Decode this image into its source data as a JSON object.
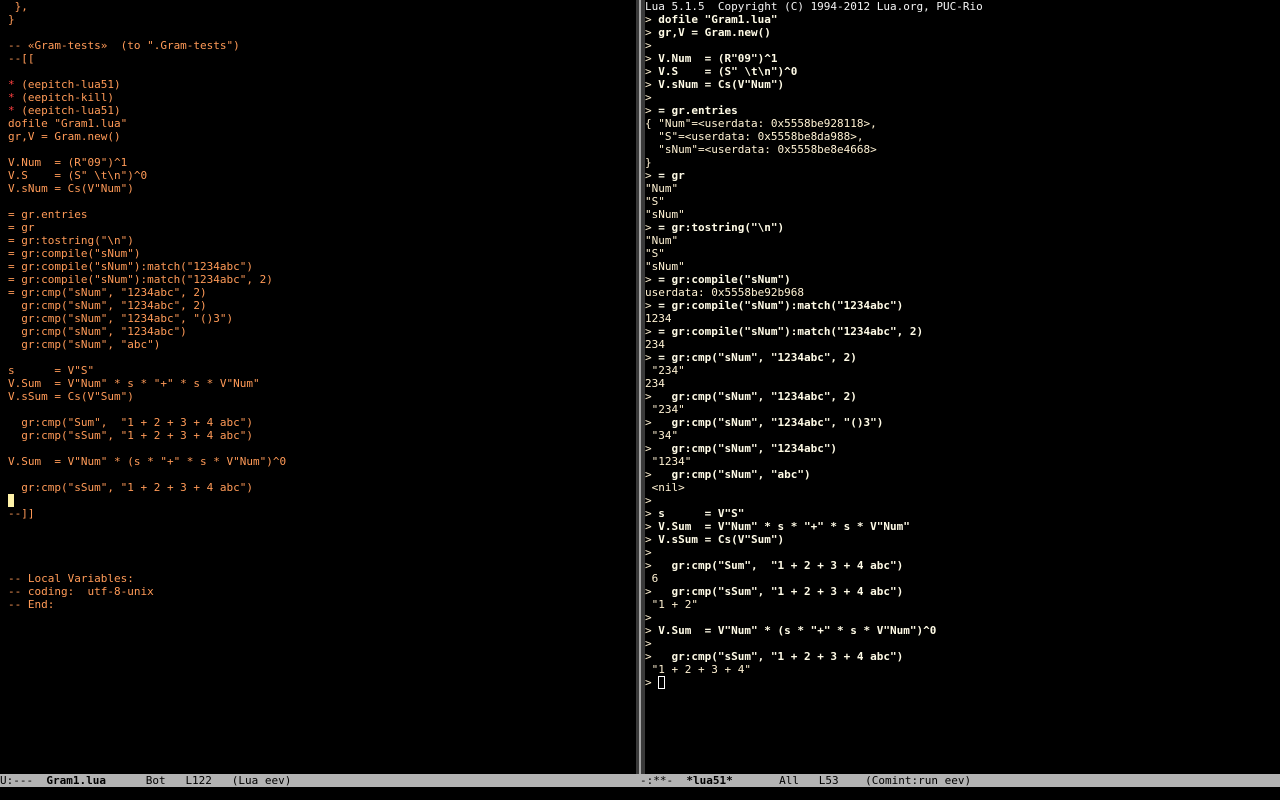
{
  "left_buffer": {
    "lines": [
      {
        "text": " },",
        "color": "orange"
      },
      {
        "text": "}",
        "color": "orange"
      },
      {
        "text": "",
        "color": "orange"
      },
      {
        "text": "-- «Gram-tests»  (to \".Gram-tests\")",
        "color": "orange"
      },
      {
        "text": "--[[",
        "color": "orange"
      },
      {
        "text": "",
        "color": "orange"
      },
      {
        "star": "*",
        "text": " (eepitch-lua51)",
        "color": "orange"
      },
      {
        "star": "*",
        "text": " (eepitch-kill)",
        "color": "orange"
      },
      {
        "star": "*",
        "text": " (eepitch-lua51)",
        "color": "orange"
      },
      {
        "text": "dofile \"Gram1.lua\"",
        "color": "orange"
      },
      {
        "text": "gr,V = Gram.new()",
        "color": "orange"
      },
      {
        "text": "",
        "color": "orange"
      },
      {
        "text": "V.Num  = (R\"09\")^1",
        "color": "orange"
      },
      {
        "text": "V.S    = (S\" \\t\\n\")^0",
        "color": "orange"
      },
      {
        "text": "V.sNum = Cs(V\"Num\")",
        "color": "orange"
      },
      {
        "text": "",
        "color": "orange"
      },
      {
        "text": "= gr.entries",
        "color": "orange"
      },
      {
        "text": "= gr",
        "color": "orange"
      },
      {
        "text": "= gr:tostring(\"\\n\")",
        "color": "orange"
      },
      {
        "text": "= gr:compile(\"sNum\")",
        "color": "orange"
      },
      {
        "text": "= gr:compile(\"sNum\"):match(\"1234abc\")",
        "color": "orange"
      },
      {
        "text": "= gr:compile(\"sNum\"):match(\"1234abc\", 2)",
        "color": "orange"
      },
      {
        "text": "= gr:cmp(\"sNum\", \"1234abc\", 2)",
        "color": "orange"
      },
      {
        "text": "  gr:cmp(\"sNum\", \"1234abc\", 2)",
        "color": "orange"
      },
      {
        "text": "  gr:cmp(\"sNum\", \"1234abc\", \"()3\")",
        "color": "orange"
      },
      {
        "text": "  gr:cmp(\"sNum\", \"1234abc\")",
        "color": "orange"
      },
      {
        "text": "  gr:cmp(\"sNum\", \"abc\")",
        "color": "orange"
      },
      {
        "text": "",
        "color": "orange"
      },
      {
        "text": "s      = V\"S\"",
        "color": "orange"
      },
      {
        "text": "V.Sum  = V\"Num\" * s * \"+\" * s * V\"Num\"",
        "color": "orange"
      },
      {
        "text": "V.sSum = Cs(V\"Sum\")",
        "color": "orange"
      },
      {
        "text": "",
        "color": "orange"
      },
      {
        "text": "  gr:cmp(\"Sum\",  \"1 + 2 + 3 + 4 abc\")",
        "color": "orange"
      },
      {
        "text": "  gr:cmp(\"sSum\", \"1 + 2 + 3 + 4 abc\")",
        "color": "orange"
      },
      {
        "text": "",
        "color": "orange"
      },
      {
        "text": "V.Sum  = V\"Num\" * (s * \"+\" * s * V\"Num\")^0",
        "color": "orange"
      },
      {
        "text": "",
        "color": "orange"
      },
      {
        "text": "  gr:cmp(\"sSum\", \"1 + 2 + 3 + 4 abc\")",
        "color": "orange"
      },
      {
        "text": "",
        "color": "orange",
        "cursor": true
      },
      {
        "text": "--]]",
        "color": "orange"
      },
      {
        "text": "",
        "color": "orange"
      },
      {
        "text": "",
        "color": "orange"
      },
      {
        "text": "",
        "color": "orange"
      },
      {
        "text": "",
        "color": "orange"
      },
      {
        "text": "-- Local Variables:",
        "color": "orange"
      },
      {
        "text": "-- coding:  utf-8-unix",
        "color": "orange"
      },
      {
        "text": "-- End:",
        "color": "orange"
      }
    ]
  },
  "right_buffer": {
    "lines": [
      {
        "text": "Lua 5.1.5  Copyright (C) 1994-2012 Lua.org, PUC-Rio",
        "color": "white"
      },
      {
        "prompt": "> ",
        "text": "dofile \"Gram1.lua\"",
        "color": "bold"
      },
      {
        "prompt": "> ",
        "text": "gr,V = Gram.new()",
        "color": "bold"
      },
      {
        "prompt": "> ",
        "text": "",
        "color": "bold"
      },
      {
        "prompt": "> ",
        "text": "V.Num  = (R\"09\")^1",
        "color": "bold"
      },
      {
        "prompt": "> ",
        "text": "V.S    = (S\" \\t\\n\")^0",
        "color": "bold"
      },
      {
        "prompt": "> ",
        "text": "V.sNum = Cs(V\"Num\")",
        "color": "bold"
      },
      {
        "prompt": "> ",
        "text": "",
        "color": "bold"
      },
      {
        "prompt": "> ",
        "text": "= gr.entries",
        "color": "bold"
      },
      {
        "text": "{ \"Num\"=<userdata: 0x5558be928118>,",
        "color": "cream"
      },
      {
        "text": "  \"S\"=<userdata: 0x5558be8da988>,",
        "color": "cream"
      },
      {
        "text": "  \"sNum\"=<userdata: 0x5558be8e4668>",
        "color": "cream"
      },
      {
        "text": "}",
        "color": "cream"
      },
      {
        "prompt": "> ",
        "text": "= gr",
        "color": "bold"
      },
      {
        "text": "\"Num\"",
        "color": "cream"
      },
      {
        "text": "\"S\"",
        "color": "cream"
      },
      {
        "text": "\"sNum\"",
        "color": "cream"
      },
      {
        "prompt": "> ",
        "text": "= gr:tostring(\"\\n\")",
        "color": "bold"
      },
      {
        "text": "\"Num\"",
        "color": "cream"
      },
      {
        "text": "\"S\"",
        "color": "cream"
      },
      {
        "text": "\"sNum\"",
        "color": "cream"
      },
      {
        "prompt": "> ",
        "text": "= gr:compile(\"sNum\")",
        "color": "bold"
      },
      {
        "text": "userdata: 0x5558be92b968",
        "color": "cream"
      },
      {
        "prompt": "> ",
        "text": "= gr:compile(\"sNum\"):match(\"1234abc\")",
        "color": "bold"
      },
      {
        "text": "1234",
        "color": "cream"
      },
      {
        "prompt": "> ",
        "text": "= gr:compile(\"sNum\"):match(\"1234abc\", 2)",
        "color": "bold"
      },
      {
        "text": "234",
        "color": "cream"
      },
      {
        "prompt": "> ",
        "text": "= gr:cmp(\"sNum\", \"1234abc\", 2)",
        "color": "bold"
      },
      {
        "text": " \"234\"",
        "color": "cream"
      },
      {
        "text": "234",
        "color": "cream"
      },
      {
        "prompt": "> ",
        "text": "  gr:cmp(\"sNum\", \"1234abc\", 2)",
        "color": "bold"
      },
      {
        "text": " \"234\"",
        "color": "cream"
      },
      {
        "prompt": "> ",
        "text": "  gr:cmp(\"sNum\", \"1234abc\", \"()3\")",
        "color": "bold"
      },
      {
        "text": " \"34\"",
        "color": "cream"
      },
      {
        "prompt": "> ",
        "text": "  gr:cmp(\"sNum\", \"1234abc\")",
        "color": "bold"
      },
      {
        "text": " \"1234\"",
        "color": "cream"
      },
      {
        "prompt": "> ",
        "text": "  gr:cmp(\"sNum\", \"abc\")",
        "color": "bold"
      },
      {
        "text": " <nil>",
        "color": "cream"
      },
      {
        "prompt": "> ",
        "text": "",
        "color": "bold"
      },
      {
        "prompt": "> ",
        "text": "s      = V\"S\"",
        "color": "bold"
      },
      {
        "prompt": "> ",
        "text": "V.Sum  = V\"Num\" * s * \"+\" * s * V\"Num\"",
        "color": "bold"
      },
      {
        "prompt": "> ",
        "text": "V.sSum = Cs(V\"Sum\")",
        "color": "bold"
      },
      {
        "prompt": "> ",
        "text": "",
        "color": "bold"
      },
      {
        "prompt": "> ",
        "text": "  gr:cmp(\"Sum\",  \"1 + 2 + 3 + 4 abc\")",
        "color": "bold"
      },
      {
        "text": " 6",
        "color": "cream"
      },
      {
        "prompt": "> ",
        "text": "  gr:cmp(\"sSum\", \"1 + 2 + 3 + 4 abc\")",
        "color": "bold"
      },
      {
        "text": " \"1 + 2\"",
        "color": "cream"
      },
      {
        "prompt": "> ",
        "text": "",
        "color": "bold"
      },
      {
        "prompt": "> ",
        "text": "V.Sum  = V\"Num\" * (s * \"+\" * s * V\"Num\")^0",
        "color": "bold"
      },
      {
        "prompt": "> ",
        "text": "",
        "color": "bold"
      },
      {
        "prompt": "> ",
        "text": "  gr:cmp(\"sSum\", \"1 + 2 + 3 + 4 abc\")",
        "color": "bold"
      },
      {
        "text": " \"1 + 2 + 3 + 4\"",
        "color": "cream"
      },
      {
        "prompt": "> ",
        "text": "",
        "color": "bold",
        "cursor": true
      }
    ]
  },
  "left_modeline": {
    "status": "U:---  ",
    "buffer_name": "Gram1.lua",
    "rest": "      Bot   L122   (Lua eev)"
  },
  "right_modeline": {
    "status": "-:**-  ",
    "buffer_name": "*lua51*",
    "rest": "       All   L53    (Comint:run eev)"
  },
  "colors": {
    "background": "#000000",
    "code_orange": "#ff9a57",
    "star_red": "#ff4040",
    "output_cream": "#fff2d3",
    "modeline_bg": "#b3b3b3",
    "divider": "#a8a8a8"
  }
}
